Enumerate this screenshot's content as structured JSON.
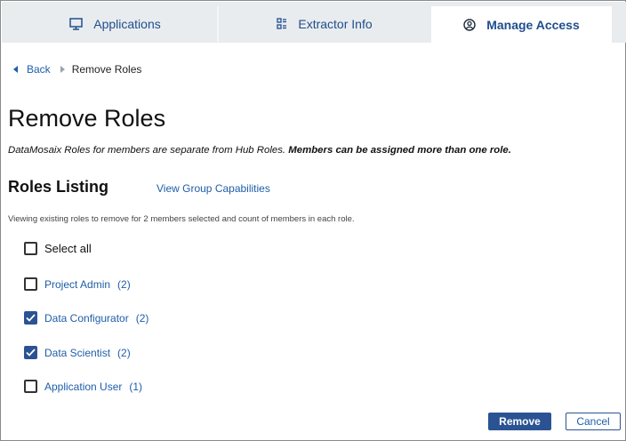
{
  "tabs": [
    {
      "label": "Applications",
      "icon": "monitor-icon",
      "active": false
    },
    {
      "label": "Extractor Info",
      "icon": "extractor-icon",
      "active": false
    },
    {
      "label": "Manage Access",
      "icon": "user-circle-icon",
      "active": true
    }
  ],
  "breadcrumb": {
    "back_label": "Back",
    "current": "Remove Roles"
  },
  "page": {
    "title": "Remove Roles",
    "description_italic": "DataMosaix Roles for members are separate from Hub Roles. ",
    "description_bold": "Members can be assigned more than one role.",
    "roles_heading": "Roles Listing",
    "group_link": "View Group Capabilities",
    "info": "Viewing existing roles to remove for 2 members selected and count of members in each role."
  },
  "select_all": {
    "label": "Select all",
    "checked": false
  },
  "roles": [
    {
      "name": "Project Admin",
      "count": "(2)",
      "checked": false
    },
    {
      "name": "Data Configurator",
      "count": "(2)",
      "checked": true
    },
    {
      "name": "Data Scientist",
      "count": "(2)",
      "checked": true
    },
    {
      "name": "Application User",
      "count": "(1)",
      "checked": false
    }
  ],
  "actions": {
    "remove_label": "Remove",
    "cancel_label": "Cancel"
  },
  "colors": {
    "accent": "#2b5393",
    "link": "#1f5ea8",
    "tab_bg": "#e9ecef"
  }
}
